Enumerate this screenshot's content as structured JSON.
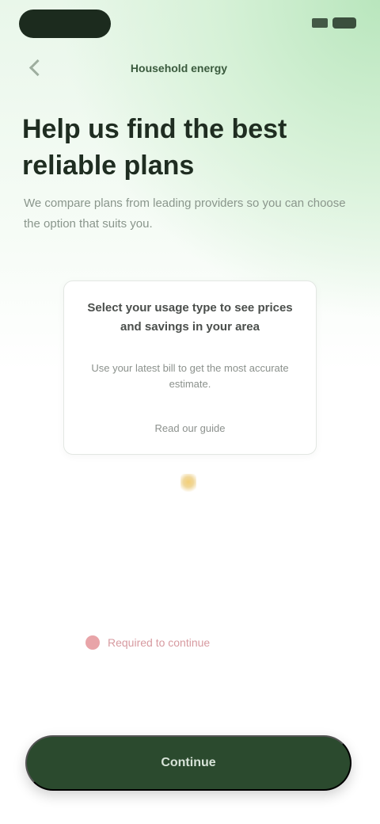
{
  "nav": {
    "title": "Household energy"
  },
  "headline": "Help us find the best reliable plans",
  "subtext": "We compare plans from leading providers so you can choose the option that suits you.",
  "card": {
    "title": "Select your usage type to see prices and savings in your area",
    "body": "Use your latest bill to get the most accurate estimate.",
    "link": "Read our guide"
  },
  "warning": {
    "text": "Required to continue"
  },
  "cta": {
    "label": "Continue"
  },
  "colors": {
    "primary": "#2b4a2e",
    "accent_bg": "#b9e6bd",
    "warning": "#e59a9f"
  },
  "icons": {
    "back": "chevron-left-icon",
    "spark": "spark-icon",
    "warning": "warning-icon"
  }
}
